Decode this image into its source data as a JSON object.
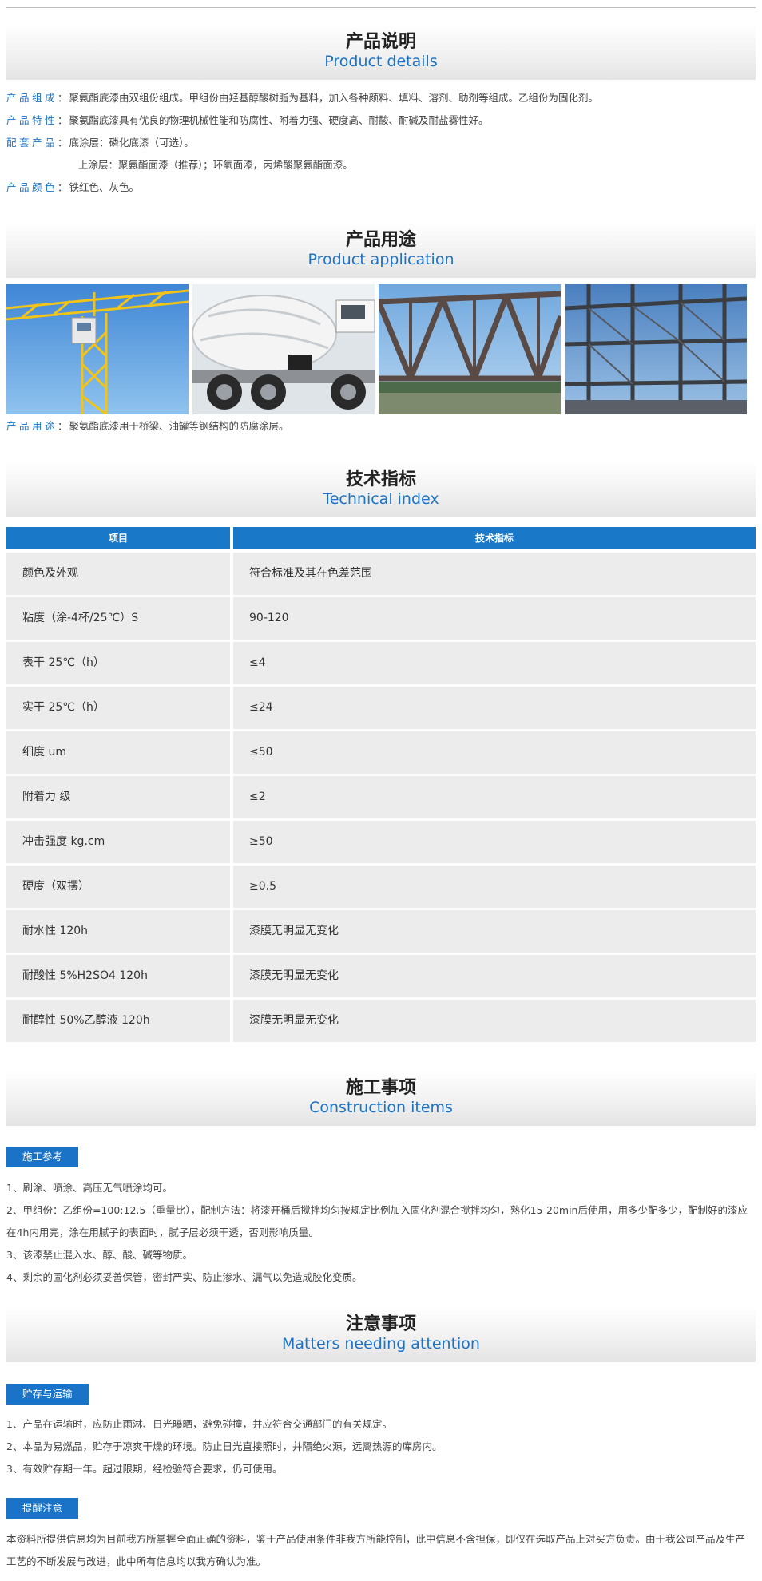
{
  "sections": {
    "details": {
      "zh": "产品说明",
      "en": "Product details"
    },
    "application": {
      "zh": "产品用途",
      "en": "Product application"
    },
    "technical": {
      "zh": "技术指标",
      "en": "Technical index"
    },
    "construction": {
      "zh": "施工事项",
      "en": "Construction items"
    },
    "attention": {
      "zh": "注意事项",
      "en": "Matters needing attention"
    }
  },
  "details": {
    "composition": {
      "label": "产品组成",
      "text": "聚氨酯底漆由双组份组成。甲组份由羟基醇酸树脂为基料，加入各种颜料、填料、溶剂、助剂等组成。乙组份为固化剂。"
    },
    "features": {
      "label": "产品特性",
      "text": "聚氨酯底漆具有优良的物理机械性能和防腐性、附着力强、硬度高、耐酸、耐碱及耐盐雾性好。"
    },
    "matching": {
      "label": "配套产品",
      "text": "底涂层：磷化底漆（可选）。",
      "text2": "上涂层：聚氨酯面漆（推荐）；环氧面漆，丙烯酸聚氨酯面漆。"
    },
    "colors": {
      "label": "产品颜色",
      "text": "铁红色、灰色。"
    }
  },
  "application": {
    "label": "产品用途",
    "text": "聚氨酯底漆用于桥梁、油罐等钢结构的防腐涂层。"
  },
  "table": {
    "headers": [
      "项目",
      "技术指标"
    ],
    "rows": [
      [
        "颜色及外观",
        "符合标准及其在色差范围"
      ],
      [
        "粘度（涂-4杯/25℃）S",
        "90-120"
      ],
      [
        "表干 25℃（h）",
        "≤4"
      ],
      [
        "实干 25℃（h）",
        "≤24"
      ],
      [
        "细度 um",
        "≤50"
      ],
      [
        "附着力 级",
        "≤2"
      ],
      [
        "冲击强度 kg.cm",
        "≥50"
      ],
      [
        "硬度（双摆）",
        "≥0.5"
      ],
      [
        "耐水性 120h",
        "漆膜无明显无变化"
      ],
      [
        "耐酸性 5%H2SO4 120h",
        "漆膜无明显无变化"
      ],
      [
        "耐醇性 50%乙醇液 120h",
        "漆膜无明显无变化"
      ]
    ]
  },
  "construction": {
    "tag": "施工参考",
    "items": [
      "1、刷涂、喷涂、高压无气喷涂均可。",
      "2、甲组份：乙组份=100:12.5（重量比），配制方法：将漆开桶后搅拌均匀按规定比例加入固化剂混合搅拌均匀，熟化15-20min后使用，用多少配多少，配制好的漆应在4h内用完，涂在用腻子的表面时，腻子层必须干透，否则影响质量。",
      "3、该漆禁止混入水、醇、酸、碱等物质。",
      "4、剩余的固化剂必须妥善保管，密封严实、防止渗水、漏气以免造成胶化变质。"
    ]
  },
  "attention": {
    "tag1": "贮存与运输",
    "items": [
      "1、产品在运输时，应防止雨淋、日光曝晒，避免碰撞，并应符合交通部门的有关规定。",
      "2、本品为易燃品，贮存于凉爽干燥的环境。防止日光直接照时，并隔绝火源，远离热源的库房内。",
      "3、有效贮存期一年。超过限期，经检验符合要求，仍可使用。"
    ],
    "tag2": "提醒注意",
    "notice": "本资料所提供信息均为目前我方所掌握全面正确的资料，鉴于产品使用条件非我方所能控制，此中信息不含担保，即仅在选取产品上对买方负责。由于我公司产品及生产工艺的不断发展与改进，此中所有信息均以我方确认为准。"
  },
  "colors": {
    "accent": "#1a73c6",
    "table_header": "#1a78c8",
    "table_cell": "#ececec"
  }
}
